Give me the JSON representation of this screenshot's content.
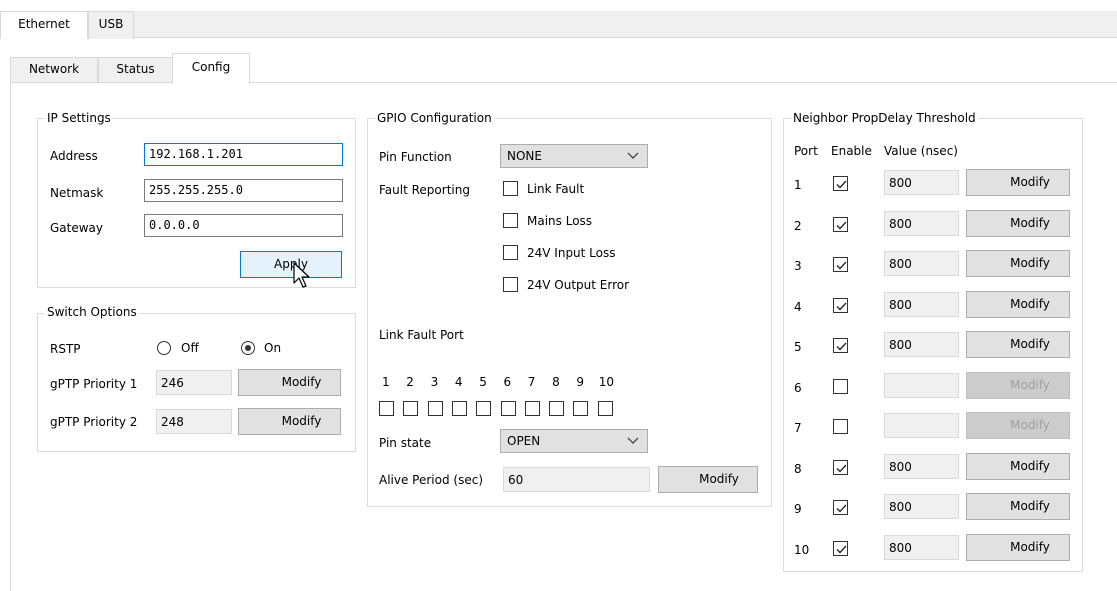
{
  "outer_tabs": [
    {
      "label": "Ethernet",
      "active": true
    },
    {
      "label": "USB",
      "active": false
    }
  ],
  "inner_tabs": [
    {
      "label": "Network",
      "active": false
    },
    {
      "label": "Status",
      "active": false
    },
    {
      "label": "Config",
      "active": true
    }
  ],
  "ip_settings": {
    "title": "IP Settings",
    "address_label": "Address",
    "address_value": "192.168.1.201",
    "netmask_label": "Netmask",
    "netmask_value": "255.255.255.0",
    "gateway_label": "Gateway",
    "gateway_value": "0.0.0.0",
    "apply_label": "Apply"
  },
  "switch_options": {
    "title": "Switch Options",
    "rstp_label": "RSTP",
    "off_label": "Off",
    "on_label": "On",
    "rstp_selected": "On",
    "gptp1_label": "gPTP Priority 1",
    "gptp1_value": "246",
    "gptp2_label": "gPTP Priority 2",
    "gptp2_value": "248",
    "modify_label": "Modify"
  },
  "gpio": {
    "title": "GPIO Configuration",
    "pin_function_label": "Pin Function",
    "pin_function_value": "NONE",
    "fault_reporting_label": "Fault Reporting",
    "faults": [
      {
        "label": "Link Fault",
        "checked": false
      },
      {
        "label": "Mains Loss",
        "checked": false
      },
      {
        "label": "24V Input Loss",
        "checked": false
      },
      {
        "label": "24V Output Error",
        "checked": false
      }
    ],
    "link_fault_port_label": "Link Fault Port",
    "ports": [
      "1",
      "2",
      "3",
      "4",
      "5",
      "6",
      "7",
      "8",
      "9",
      "10"
    ],
    "pin_state_label": "Pin state",
    "pin_state_value": "OPEN",
    "alive_period_label": "Alive Period (sec)",
    "alive_period_value": "60",
    "modify_label": "Modify"
  },
  "neighbor": {
    "title": "Neighbor PropDelay Threshold",
    "port_header": "Port",
    "enable_header": "Enable",
    "value_header": "Value (nsec)",
    "modify_label": "Modify",
    "rows": [
      {
        "port": "1",
        "enabled": true,
        "value": "800"
      },
      {
        "port": "2",
        "enabled": true,
        "value": "800"
      },
      {
        "port": "3",
        "enabled": true,
        "value": "800"
      },
      {
        "port": "4",
        "enabled": true,
        "value": "800"
      },
      {
        "port": "5",
        "enabled": true,
        "value": "800"
      },
      {
        "port": "6",
        "enabled": false,
        "value": ""
      },
      {
        "port": "7",
        "enabled": false,
        "value": ""
      },
      {
        "port": "8",
        "enabled": true,
        "value": "800"
      },
      {
        "port": "9",
        "enabled": true,
        "value": "800"
      },
      {
        "port": "10",
        "enabled": true,
        "value": "800"
      }
    ]
  }
}
